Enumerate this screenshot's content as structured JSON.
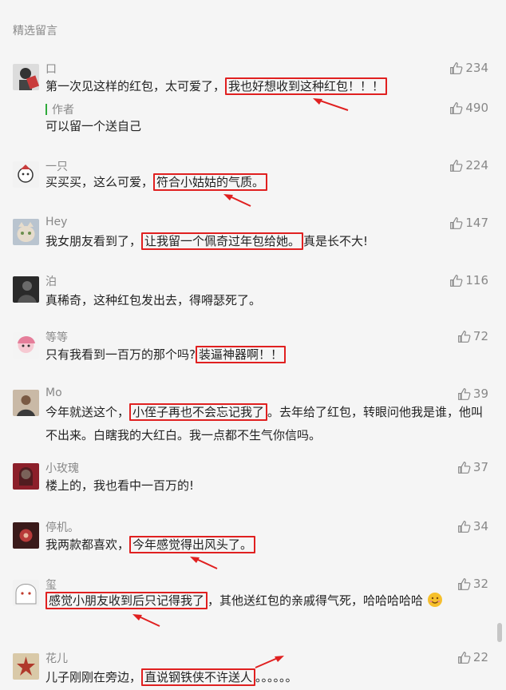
{
  "section_title": "精选留言",
  "colors": {
    "highlight": "#e02020",
    "author_bar": "#2eaa3a",
    "muted": "#888888"
  },
  "comments": [
    {
      "nickname": "口",
      "avatar": "avatar-boy-icon",
      "segments": [
        "第一次见这样的红包，太可爱了，",
        "我也好想收到这种红包！！！",
        ""
      ],
      "likes": "234",
      "reply": {
        "label": "作者",
        "text": "可以留一个送自己",
        "likes": "490"
      }
    },
    {
      "nickname": "一只",
      "avatar": "avatar-cartoon-icon",
      "segments": [
        "买买买，这么可爱，",
        "符合小姑姑的气质。",
        ""
      ],
      "likes": "224"
    },
    {
      "nickname": "Hey",
      "avatar": "avatar-cat-icon",
      "segments": [
        "我女朋友看到了，",
        "让我留一个佩奇过年包给她。",
        "真是长不大!"
      ],
      "likes": "147"
    },
    {
      "nickname": "泊",
      "avatar": "avatar-silhouette-icon",
      "segments": [
        "真稀奇，这种红包发出去，得嘚瑟死了。",
        "",
        ""
      ],
      "likes": "116"
    },
    {
      "nickname": "等等",
      "avatar": "avatar-anime-girl-icon",
      "segments": [
        "只有我看到一百万的那个吗?",
        "装逼神器啊！！",
        ""
      ],
      "likes": "72"
    },
    {
      "nickname": "Mo",
      "avatar": "avatar-photo-icon",
      "segments": [
        "今年就送这个，",
        "小侄子再也不会忘记我了",
        "。去年给了红包，转眼问他我是谁，他叫不出来。白瞎我的大红白。我一点都不生气你信吗。"
      ],
      "likes": "39"
    },
    {
      "nickname": "小玫瑰",
      "avatar": "avatar-woman-icon",
      "segments": [
        "楼上的，我也看中一百万的!",
        "",
        ""
      ],
      "likes": "37"
    },
    {
      "nickname": "停机。",
      "avatar": "avatar-flower-icon",
      "segments": [
        "我两款都喜欢，",
        "今年感觉得出风头了。",
        ""
      ],
      "likes": "34"
    },
    {
      "nickname": "玺",
      "avatar": "avatar-anime-white-icon",
      "segments": [
        "",
        "感觉小朋友收到后只记得我了",
        "，其他送红包的亲戚得气死，哈哈哈哈哈"
      ],
      "likes": "32",
      "emoji": "smile-emoji-icon"
    },
    {
      "nickname": "花儿",
      "avatar": "avatar-starfish-icon",
      "segments": [
        "儿子刚刚在旁边，",
        "直说钢铁侠不许送人",
        "。。。。。。"
      ],
      "likes": "22"
    }
  ]
}
